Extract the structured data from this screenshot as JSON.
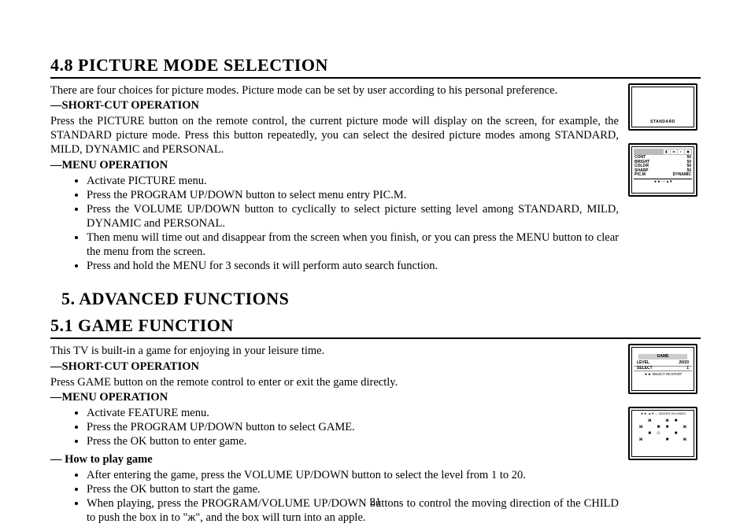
{
  "pageNumber": "21",
  "sec48": {
    "heading": "4.8 PICTURE MODE SELECTION",
    "intro": "There are four choices for picture modes. Picture mode can be set by user according to his personal preference.",
    "shortcut_heading": "—SHORT-CUT OPERATION",
    "shortcut_body": "Press the PICTURE button on the remote control, the current picture mode will display on the screen, for example, the STANDARD picture mode. Press this button repeatedly, you can select the desired picture modes among STANDARD, MILD, DYNAMIC and PERSONAL.",
    "menu_heading": "—MENU OPERATION",
    "menu_items": [
      "Activate PICTURE menu.",
      "Press the PROGRAM UP/DOWN button to select menu entry PIC.M.",
      "Press the VOLUME UP/DOWN button to cyclically to select picture setting level among STANDARD, MILD, DYNAMIC and PERSONAL.",
      "Then menu will time out and disappear from the screen when you finish, or you can press the MENU button to clear the menu from the screen.",
      "Press and hold the MENU for 3 seconds it will perform auto search function."
    ]
  },
  "sec5": {
    "heading": "5.   ADVANCED FUNCTIONS"
  },
  "sec51": {
    "heading": "5.1 GAME FUNCTION",
    "intro": "This TV is built-in a game for enjoying in your leisure time.",
    "shortcut_heading": "—SHORT-CUT OPERATION",
    "shortcut_body": "Press GAME button on the remote control to enter or exit the game directly.",
    "menu_heading": "—MENU OPERATION",
    "menu_items": [
      "Activate FEATURE menu.",
      "Press the PROGRAM UP/DOWN button to select GAME.",
      "Press the OK button to enter game."
    ],
    "howto_heading": "— How to play game",
    "howto_items": [
      "After entering the game, press the VOLUME UP/DOWN button to select the level from 1 to 20.",
      "Press the OK button to start the game.",
      "When playing, press the PROGRAM/VOLUME UP/DOWN buttons to control the moving direction of the CHILD to push the box in to \"ж\", and the box will turn into an apple."
    ]
  },
  "fig": {
    "standard": "STANDARD",
    "picture_menu": {
      "rows": [
        [
          "CONT",
          "50"
        ],
        [
          "BRIGHT",
          "50"
        ],
        [
          "COLOR",
          "50"
        ],
        [
          "SHARP",
          "50"
        ],
        [
          "PIC.M",
          "DYNAMIC"
        ]
      ],
      "footer": "◄ ► — ▲▼"
    },
    "game_menu": {
      "title": "GAME",
      "rows": [
        [
          "LEVEL",
          "20/20"
        ],
        [
          "SELECT",
          "1"
        ]
      ],
      "footer": "◄ ► SELECT   OK:START"
    },
    "game_grid": {
      "header": "◄ ► ▲▼ — BOXES   OK:UNDO"
    }
  }
}
